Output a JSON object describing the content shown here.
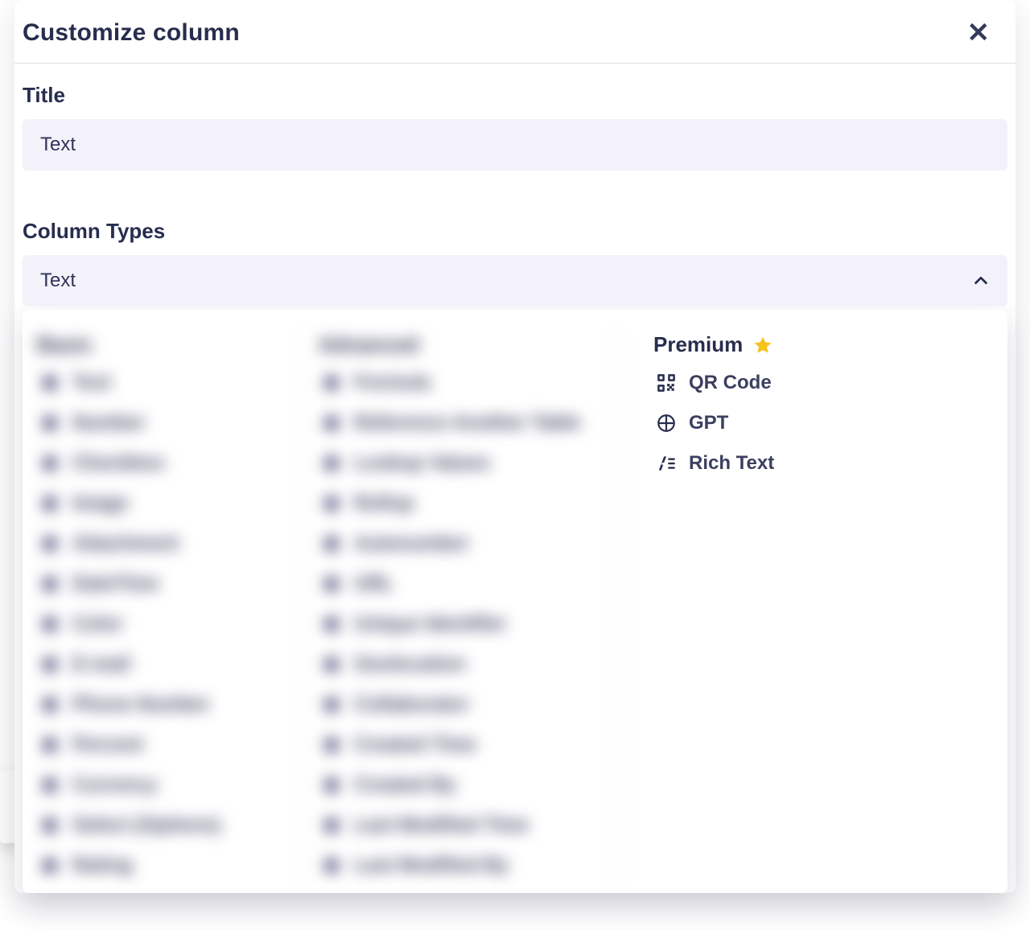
{
  "modal": {
    "title": "Customize column",
    "title_label": "Title",
    "title_value": "Text",
    "types_label": "Column Types",
    "types_value": "Text"
  },
  "columns": {
    "basic": {
      "heading": "Basic",
      "items": [
        {
          "label": "Text",
          "icon": "text"
        },
        {
          "label": "Number",
          "icon": "number"
        },
        {
          "label": "Checkbox",
          "icon": "checkbox"
        },
        {
          "label": "Image",
          "icon": "image"
        },
        {
          "label": "Attachment",
          "icon": "attachment"
        },
        {
          "label": "DateTime",
          "icon": "datetime"
        },
        {
          "label": "Color",
          "icon": "color"
        },
        {
          "label": "E-mail",
          "icon": "email"
        },
        {
          "label": "Phone Number",
          "icon": "phone"
        },
        {
          "label": "Percent",
          "icon": "percent"
        },
        {
          "label": "Currency",
          "icon": "currency"
        },
        {
          "label": "Select (Options)",
          "icon": "select"
        },
        {
          "label": "Rating",
          "icon": "rating"
        }
      ]
    },
    "advanced": {
      "heading": "Advanced",
      "items": [
        {
          "label": "Formula",
          "icon": "formula"
        },
        {
          "label": "Reference Another Table",
          "icon": "reference"
        },
        {
          "label": "Lookup Values",
          "icon": "lookup"
        },
        {
          "label": "Rollup",
          "icon": "rollup"
        },
        {
          "label": "Autonumber",
          "icon": "autonumber"
        },
        {
          "label": "URL",
          "icon": "url"
        },
        {
          "label": "Unique Identifier",
          "icon": "uid"
        },
        {
          "label": "Geolocation",
          "icon": "geo"
        },
        {
          "label": "Collaborator",
          "icon": "collab"
        },
        {
          "label": "Created Time",
          "icon": "created-time"
        },
        {
          "label": "Created By",
          "icon": "created-by"
        },
        {
          "label": "Last Modified Time",
          "icon": "mod-time"
        },
        {
          "label": "Last Modified By",
          "icon": "mod-by"
        }
      ]
    },
    "premium": {
      "heading": "Premium",
      "items": [
        {
          "label": "QR Code",
          "icon": "qr"
        },
        {
          "label": "GPT",
          "icon": "gpt"
        },
        {
          "label": "Rich Text",
          "icon": "richtext"
        }
      ]
    }
  }
}
